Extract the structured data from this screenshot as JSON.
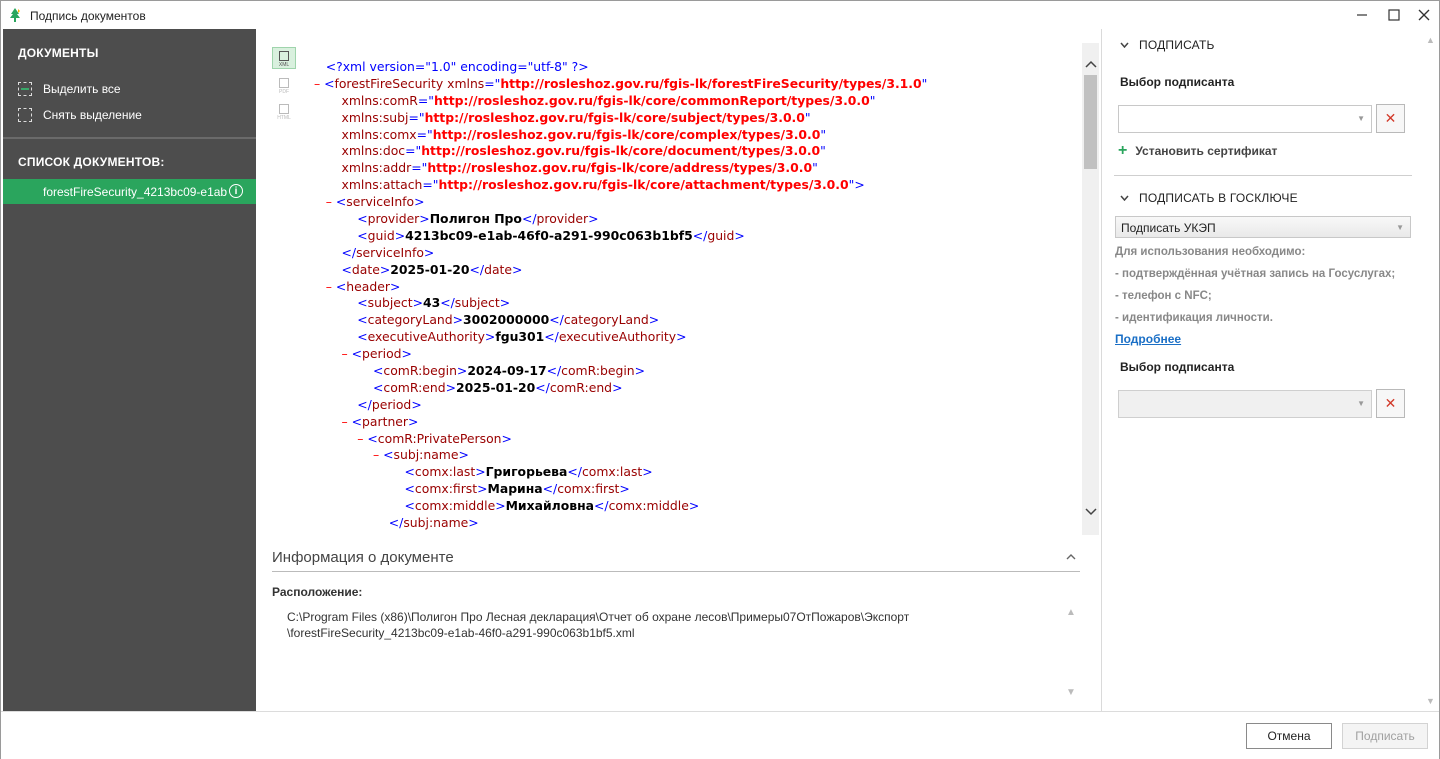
{
  "window": {
    "title": "Подпись документов"
  },
  "sidebar": {
    "documents_heading": "ДОКУМЕНТЫ",
    "select_all": "Выделить все",
    "deselect": "Снять выделение",
    "list_heading": "СПИСОК ДОКУМЕНТОВ:",
    "items": [
      {
        "label": "forestFireSecurity_4213bc09-e1ab",
        "selected": true
      }
    ]
  },
  "viewer": {
    "formats": [
      "XML",
      "PDF",
      "HTML"
    ],
    "active_format": "XML",
    "xml_lines": [
      [
        [
          "t-pi",
          "    <?xml version=\"1.0\" encoding=\"utf-8\" ?>"
        ]
      ],
      [
        [
          "t-m",
          " – "
        ],
        [
          "t-br",
          "<"
        ],
        [
          "t-el",
          "forestFireSecurity"
        ],
        [
          "t-at",
          " xmlns"
        ],
        [
          "t-br",
          "=\""
        ],
        [
          "t-av",
          "http://rosleshoz.gov.ru/fgis-lk/forestFireSecurity/types/3.1.0"
        ],
        [
          "t-br",
          "\""
        ]
      ],
      [
        [
          "t-at",
          "        xmlns:comR"
        ],
        [
          "t-br",
          "=\""
        ],
        [
          "t-av",
          "http://rosleshoz.gov.ru/fgis-lk/core/commonReport/types/3.0.0"
        ],
        [
          "t-br",
          "\""
        ]
      ],
      [
        [
          "t-at",
          "        xmlns:subj"
        ],
        [
          "t-br",
          "=\""
        ],
        [
          "t-av",
          "http://rosleshoz.gov.ru/fgis-lk/core/subject/types/3.0.0"
        ],
        [
          "t-br",
          "\""
        ]
      ],
      [
        [
          "t-at",
          "        xmlns:comx"
        ],
        [
          "t-br",
          "=\""
        ],
        [
          "t-av",
          "http://rosleshoz.gov.ru/fgis-lk/core/complex/types/3.0.0"
        ],
        [
          "t-br",
          "\""
        ]
      ],
      [
        [
          "t-at",
          "        xmlns:doc"
        ],
        [
          "t-br",
          "=\""
        ],
        [
          "t-av",
          "http://rosleshoz.gov.ru/fgis-lk/core/document/types/3.0.0"
        ],
        [
          "t-br",
          "\""
        ]
      ],
      [
        [
          "t-at",
          "        xmlns:addr"
        ],
        [
          "t-br",
          "=\""
        ],
        [
          "t-av",
          "http://rosleshoz.gov.ru/fgis-lk/core/address/types/3.0.0"
        ],
        [
          "t-br",
          "\""
        ]
      ],
      [
        [
          "t-at",
          "        xmlns:attach"
        ],
        [
          "t-br",
          "=\""
        ],
        [
          "t-av",
          "http://rosleshoz.gov.ru/fgis-lk/core/attachment/types/3.0.0"
        ],
        [
          "t-br",
          "\">"
        ]
      ],
      [
        [
          "t-m",
          "    – "
        ],
        [
          "t-br",
          "<"
        ],
        [
          "t-el",
          "serviceInfo"
        ],
        [
          "t-br",
          ">"
        ]
      ],
      [
        [
          "t-br",
          "            <"
        ],
        [
          "t-el",
          "provider"
        ],
        [
          "t-br",
          ">"
        ],
        [
          "t-tx",
          "Полигон Про"
        ],
        [
          "t-br",
          "</"
        ],
        [
          "t-el",
          "provider"
        ],
        [
          "t-br",
          ">"
        ]
      ],
      [
        [
          "t-br",
          "            <"
        ],
        [
          "t-el",
          "guid"
        ],
        [
          "t-br",
          ">"
        ],
        [
          "t-tx",
          "4213bc09-e1ab-46f0-a291-990c063b1bf5"
        ],
        [
          "t-br",
          "</"
        ],
        [
          "t-el",
          "guid"
        ],
        [
          "t-br",
          ">"
        ]
      ],
      [
        [
          "t-br",
          "        </"
        ],
        [
          "t-el",
          "serviceInfo"
        ],
        [
          "t-br",
          ">"
        ]
      ],
      [
        [
          "t-br",
          "        <"
        ],
        [
          "t-el",
          "date"
        ],
        [
          "t-br",
          ">"
        ],
        [
          "t-tx",
          "2025-01-20"
        ],
        [
          "t-br",
          "</"
        ],
        [
          "t-el",
          "date"
        ],
        [
          "t-br",
          ">"
        ]
      ],
      [
        [
          "t-m",
          "    – "
        ],
        [
          "t-br",
          "<"
        ],
        [
          "t-el",
          "header"
        ],
        [
          "t-br",
          ">"
        ]
      ],
      [
        [
          "t-br",
          "            <"
        ],
        [
          "t-el",
          "subject"
        ],
        [
          "t-br",
          ">"
        ],
        [
          "t-tx",
          "43"
        ],
        [
          "t-br",
          "</"
        ],
        [
          "t-el",
          "subject"
        ],
        [
          "t-br",
          ">"
        ]
      ],
      [
        [
          "t-br",
          "            <"
        ],
        [
          "t-el",
          "categoryLand"
        ],
        [
          "t-br",
          ">"
        ],
        [
          "t-tx",
          "3002000000"
        ],
        [
          "t-br",
          "</"
        ],
        [
          "t-el",
          "categoryLand"
        ],
        [
          "t-br",
          ">"
        ]
      ],
      [
        [
          "t-br",
          "            <"
        ],
        [
          "t-el",
          "executiveAuthority"
        ],
        [
          "t-br",
          ">"
        ],
        [
          "t-tx",
          "fgu301"
        ],
        [
          "t-br",
          "</"
        ],
        [
          "t-el",
          "executiveAuthority"
        ],
        [
          "t-br",
          ">"
        ]
      ],
      [
        [
          "t-m",
          "        – "
        ],
        [
          "t-br",
          "<"
        ],
        [
          "t-el",
          "period"
        ],
        [
          "t-br",
          ">"
        ]
      ],
      [
        [
          "t-br",
          "                <"
        ],
        [
          "t-el",
          "comR:begin"
        ],
        [
          "t-br",
          ">"
        ],
        [
          "t-tx",
          "2024-09-17"
        ],
        [
          "t-br",
          "</"
        ],
        [
          "t-el",
          "comR:begin"
        ],
        [
          "t-br",
          ">"
        ]
      ],
      [
        [
          "t-br",
          "                <"
        ],
        [
          "t-el",
          "comR:end"
        ],
        [
          "t-br",
          ">"
        ],
        [
          "t-tx",
          "2025-01-20"
        ],
        [
          "t-br",
          "</"
        ],
        [
          "t-el",
          "comR:end"
        ],
        [
          "t-br",
          ">"
        ]
      ],
      [
        [
          "t-br",
          "            </"
        ],
        [
          "t-el",
          "period"
        ],
        [
          "t-br",
          ">"
        ]
      ],
      [
        [
          "t-m",
          "        – "
        ],
        [
          "t-br",
          "<"
        ],
        [
          "t-el",
          "partner"
        ],
        [
          "t-br",
          ">"
        ]
      ],
      [
        [
          "t-m",
          "            – "
        ],
        [
          "t-br",
          "<"
        ],
        [
          "t-el",
          "comR:PrivatePerson"
        ],
        [
          "t-br",
          ">"
        ]
      ],
      [
        [
          "t-m",
          "                – "
        ],
        [
          "t-br",
          "<"
        ],
        [
          "t-el",
          "subj:name"
        ],
        [
          "t-br",
          ">"
        ]
      ],
      [
        [
          "t-br",
          "                        <"
        ],
        [
          "t-el",
          "comx:last"
        ],
        [
          "t-br",
          ">"
        ],
        [
          "t-tx",
          "Григорьева"
        ],
        [
          "t-br",
          "</"
        ],
        [
          "t-el",
          "comx:last"
        ],
        [
          "t-br",
          ">"
        ]
      ],
      [
        [
          "t-br",
          "                        <"
        ],
        [
          "t-el",
          "comx:first"
        ],
        [
          "t-br",
          ">"
        ],
        [
          "t-tx",
          "Марина"
        ],
        [
          "t-br",
          "</"
        ],
        [
          "t-el",
          "comx:first"
        ],
        [
          "t-br",
          ">"
        ]
      ],
      [
        [
          "t-br",
          "                        <"
        ],
        [
          "t-el",
          "comx:middle"
        ],
        [
          "t-br",
          ">"
        ],
        [
          "t-tx",
          "Михайловна"
        ],
        [
          "t-br",
          "</"
        ],
        [
          "t-el",
          "comx:middle"
        ],
        [
          "t-br",
          ">"
        ]
      ],
      [
        [
          "t-br",
          "                    </"
        ],
        [
          "t-el",
          "subj:name"
        ],
        [
          "t-br",
          ">"
        ]
      ]
    ]
  },
  "info": {
    "heading": "Информация о документе",
    "location_label": "Расположение:",
    "location_line1": "C:\\Program Files (x86)\\Полигон Про Лесная декларация\\Отчет об охране лесов\\Примеры07ОтПожаров\\Экспорт",
    "location_line2": "\\forestFireSecurity_4213bc09-e1ab-46f0-a291-990c063b1bf5.xml"
  },
  "sign": {
    "heading": "ПОДПИСАТЬ",
    "signer_label": "Выбор подписанта",
    "signer_value": "",
    "install_cert": "Установить сертификат"
  },
  "goskey": {
    "heading": "ПОДПИСАТЬ В ГОСКЛЮЧЕ",
    "mode_value": "Подписать УКЭП",
    "requirements_title": "Для использования необходимо:",
    "req1": "- подтверждённая учётная запись на Госуслугах;",
    "req2": "- телефон с NFC;",
    "req3": "- идентификация личности.",
    "more_link": "Подробнее",
    "signer_label": "Выбор подписанта",
    "signer_value": ""
  },
  "footer": {
    "cancel": "Отмена",
    "sign": "Подписать"
  },
  "colors": {
    "accent": "#2aa55d",
    "sidebar_bg": "#4d4d4d",
    "link": "#1a6fc6",
    "xml_value": "#ff0000",
    "xml_bracket": "#0000ff",
    "xml_element": "#990000"
  }
}
